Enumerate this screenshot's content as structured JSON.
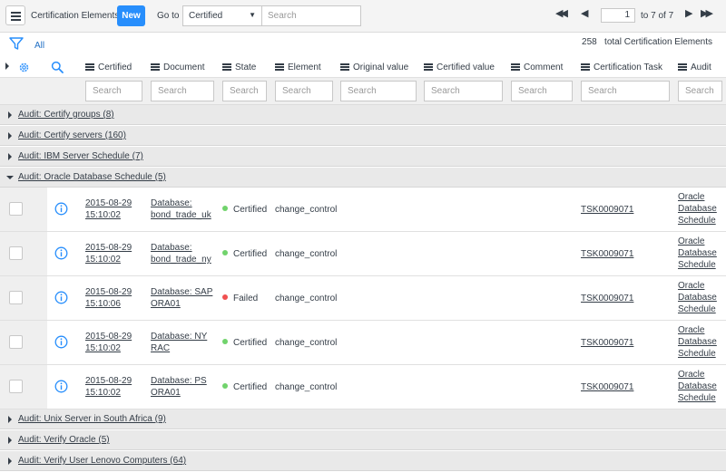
{
  "header": {
    "title": "Certification Elements",
    "new_label": "New",
    "goto_label": "Go to",
    "goto_field": "Certified",
    "search_placeholder": "Search",
    "page_input": "1",
    "page_total": "to 7 of 7"
  },
  "info": {
    "filter_label": "All",
    "total_count": "258",
    "total_label": "total Certification Elements"
  },
  "columns": [
    {
      "label": "Certified",
      "search": "Search"
    },
    {
      "label": "Document",
      "search": "Search"
    },
    {
      "label": "State",
      "search": "Search"
    },
    {
      "label": "Element",
      "search": "Search"
    },
    {
      "label": "Original value",
      "search": "Search"
    },
    {
      "label": "Certified value",
      "search": "Search"
    },
    {
      "label": "Comment",
      "search": "Search"
    },
    {
      "label": "Certification Task",
      "search": "Search"
    },
    {
      "label": "Audit",
      "search": "Search"
    }
  ],
  "groups": [
    {
      "label": "Audit: Certify groups (8)"
    },
    {
      "label": "Audit: Certify servers (160)"
    },
    {
      "label": "Audit: IBM Server Schedule (7)"
    },
    {
      "label": "Audit: Oracle Database Schedule (5)"
    },
    {
      "label": "Audit: Unix Server in South Africa (9)"
    },
    {
      "label": "Audit: Verify Oracle (5)"
    },
    {
      "label": "Audit: Verify User Lenovo Computers (64)"
    }
  ],
  "rows": [
    {
      "date": "2015-08-29",
      "time": "15:10:02",
      "doc1": "Database:",
      "doc2": "bond_trade_uk",
      "state": "Certified",
      "state_color": "#71d36c",
      "element": "change_control",
      "task": "TSK0009071",
      "audit1": "Oracle",
      "audit2": "Database",
      "audit3": "Schedule"
    },
    {
      "date": "2015-08-29",
      "time": "15:10:02",
      "doc1": "Database:",
      "doc2": "bond_trade_ny",
      "state": "Certified",
      "state_color": "#71d36c",
      "element": "change_control",
      "task": "TSK0009071",
      "audit1": "Oracle",
      "audit2": "Database",
      "audit3": "Schedule"
    },
    {
      "date": "2015-08-29",
      "time": "15:10:06",
      "doc1": "Database: SAP",
      "doc2": "ORA01",
      "state": "Failed",
      "state_color": "#f05050",
      "element": "change_control",
      "task": "TSK0009071",
      "audit1": "Oracle",
      "audit2": "Database",
      "audit3": "Schedule"
    },
    {
      "date": "2015-08-29",
      "time": "15:10:02",
      "doc1": "Database: NY",
      "doc2": "RAC",
      "state": "Certified",
      "state_color": "#71d36c",
      "element": "change_control",
      "task": "TSK0009071",
      "audit1": "Oracle",
      "audit2": "Database",
      "audit3": "Schedule"
    },
    {
      "date": "2015-08-29",
      "time": "15:10:02",
      "doc1": "Database: PS",
      "doc2": "ORA01",
      "state": "Certified",
      "state_color": "#71d36c",
      "element": "change_control",
      "task": "TSK0009071",
      "audit1": "Oracle",
      "audit2": "Database",
      "audit3": "Schedule"
    }
  ]
}
